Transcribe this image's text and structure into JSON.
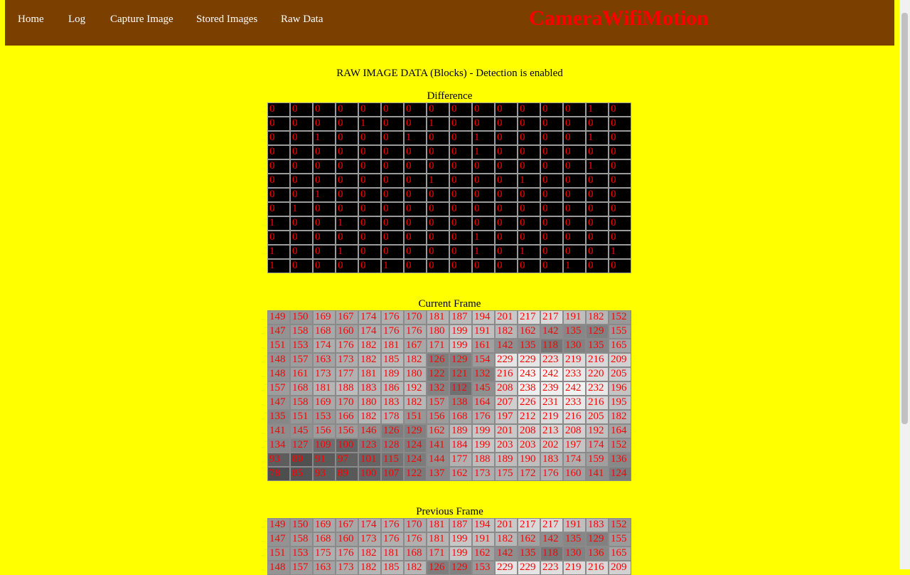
{
  "nav": {
    "items": [
      {
        "label": "Home"
      },
      {
        "label": "Log"
      },
      {
        "label": "Capture Image"
      },
      {
        "label": "Stored Images"
      },
      {
        "label": "Raw Data"
      }
    ],
    "brand": "CameraWifiMotion"
  },
  "page": {
    "heading": "RAW IMAGE DATA (Blocks) - Detection is enabled"
  },
  "difference": {
    "caption": "Difference",
    "rows": [
      [
        0,
        0,
        0,
        0,
        0,
        0,
        0,
        0,
        0,
        0,
        0,
        0,
        0,
        0,
        1,
        0
      ],
      [
        0,
        0,
        0,
        0,
        1,
        0,
        0,
        1,
        0,
        0,
        0,
        0,
        0,
        0,
        0,
        0
      ],
      [
        0,
        0,
        1,
        0,
        0,
        0,
        1,
        0,
        0,
        1,
        0,
        0,
        0,
        0,
        1,
        0
      ],
      [
        0,
        0,
        0,
        0,
        0,
        0,
        0,
        0,
        0,
        1,
        0,
        0,
        0,
        0,
        0,
        0
      ],
      [
        0,
        0,
        0,
        0,
        0,
        0,
        0,
        0,
        0,
        0,
        0,
        0,
        0,
        0,
        1,
        0
      ],
      [
        0,
        0,
        0,
        0,
        0,
        0,
        0,
        1,
        0,
        0,
        0,
        1,
        0,
        0,
        0,
        0
      ],
      [
        0,
        0,
        1,
        0,
        0,
        0,
        0,
        0,
        0,
        0,
        0,
        0,
        0,
        0,
        0,
        0
      ],
      [
        0,
        1,
        0,
        0,
        0,
        0,
        0,
        0,
        0,
        0,
        0,
        0,
        0,
        0,
        0,
        0
      ],
      [
        1,
        0,
        0,
        1,
        0,
        0,
        0,
        0,
        0,
        0,
        0,
        0,
        0,
        0,
        0,
        0
      ],
      [
        0,
        0,
        0,
        0,
        0,
        0,
        0,
        0,
        0,
        1,
        0,
        0,
        0,
        0,
        0,
        0
      ],
      [
        1,
        0,
        0,
        1,
        0,
        0,
        0,
        0,
        0,
        1,
        0,
        1,
        0,
        0,
        0,
        1
      ],
      [
        1,
        0,
        0,
        0,
        0,
        1,
        0,
        0,
        0,
        0,
        0,
        0,
        0,
        1,
        0,
        0
      ]
    ]
  },
  "current_frame": {
    "caption": "Current Frame",
    "rows": [
      [
        149,
        150,
        169,
        167,
        174,
        176,
        170,
        181,
        187,
        194,
        201,
        217,
        217,
        191,
        182,
        152
      ],
      [
        147,
        158,
        168,
        160,
        174,
        176,
        176,
        180,
        199,
        191,
        182,
        162,
        142,
        135,
        129,
        155
      ],
      [
        151,
        153,
        174,
        176,
        182,
        181,
        167,
        171,
        199,
        161,
        142,
        135,
        118,
        130,
        135,
        165
      ],
      [
        148,
        157,
        163,
        173,
        182,
        185,
        182,
        126,
        129,
        154,
        229,
        229,
        223,
        219,
        216,
        209
      ],
      [
        148,
        161,
        173,
        177,
        181,
        189,
        180,
        122,
        121,
        132,
        216,
        243,
        242,
        233,
        220,
        205
      ],
      [
        157,
        168,
        181,
        188,
        183,
        186,
        192,
        132,
        112,
        145,
        208,
        238,
        239,
        242,
        232,
        196
      ],
      [
        147,
        158,
        169,
        170,
        180,
        183,
        182,
        157,
        138,
        164,
        207,
        226,
        231,
        233,
        216,
        195
      ],
      [
        135,
        151,
        153,
        166,
        182,
        178,
        151,
        156,
        168,
        176,
        197,
        212,
        219,
        216,
        205,
        182
      ],
      [
        141,
        145,
        156,
        156,
        146,
        126,
        129,
        162,
        189,
        199,
        201,
        208,
        213,
        208,
        192,
        164
      ],
      [
        134,
        127,
        109,
        100,
        123,
        128,
        124,
        141,
        184,
        199,
        203,
        203,
        202,
        197,
        174,
        152
      ],
      [
        93,
        80,
        91,
        97,
        101,
        115,
        124,
        144,
        177,
        188,
        189,
        190,
        183,
        174,
        159,
        136
      ],
      [
        78,
        85,
        93,
        89,
        100,
        107,
        122,
        137,
        162,
        173,
        175,
        172,
        176,
        160,
        141,
        124
      ]
    ]
  },
  "previous_frame": {
    "caption": "Previous Frame",
    "rows": [
      [
        149,
        150,
        169,
        167,
        174,
        176,
        170,
        181,
        187,
        194,
        201,
        217,
        217,
        191,
        183,
        152
      ],
      [
        147,
        158,
        168,
        160,
        173,
        176,
        176,
        181,
        199,
        191,
        182,
        162,
        142,
        135,
        129,
        155
      ],
      [
        151,
        153,
        175,
        176,
        182,
        181,
        168,
        171,
        199,
        162,
        142,
        135,
        118,
        130,
        136,
        165
      ],
      [
        148,
        157,
        163,
        173,
        182,
        185,
        182,
        126,
        129,
        153,
        229,
        229,
        223,
        219,
        216,
        209
      ]
    ]
  }
}
